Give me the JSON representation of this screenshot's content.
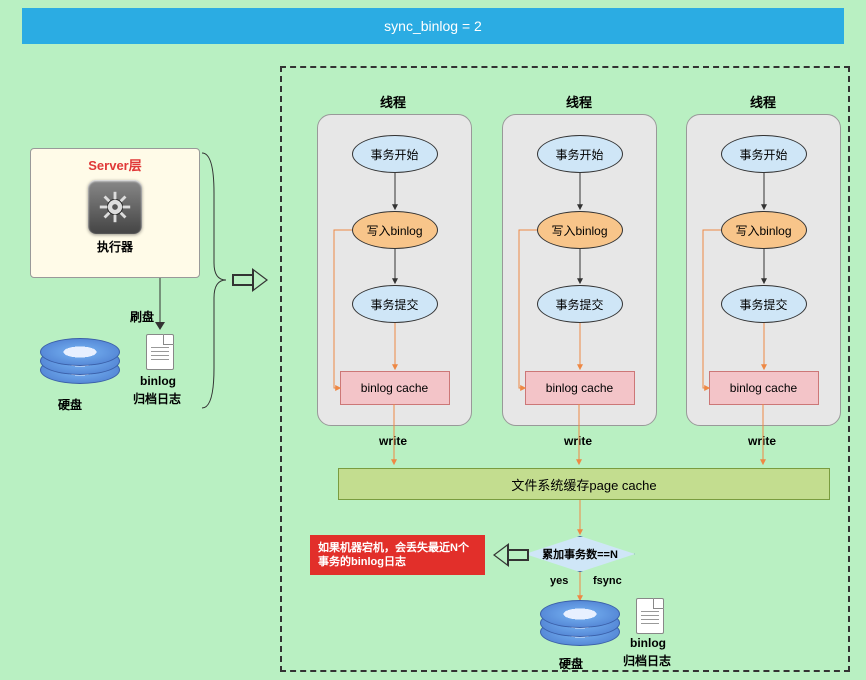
{
  "title": "sync_binlog = 2",
  "server": {
    "title": "Server层",
    "executor": "执行器"
  },
  "flush": "刷盘",
  "left_disk": {
    "label": "硬盘",
    "file": "binlog",
    "file2": "归档日志"
  },
  "threads": {
    "label": "线程"
  },
  "steps": {
    "start": "事务开始",
    "write_binlog": "写入binlog",
    "commit": "事务提交",
    "cache": "binlog cache"
  },
  "write": "write",
  "page_cache": "文件系统缓存page cache",
  "diamond": "累加事务数==N",
  "yes": "yes",
  "fsync": "fsync",
  "warning": "如果机器宕机，会丢失最近N个事务的binlog日志",
  "bottom_disk": {
    "label": "硬盘",
    "file": "binlog",
    "file2": "归档日志"
  }
}
